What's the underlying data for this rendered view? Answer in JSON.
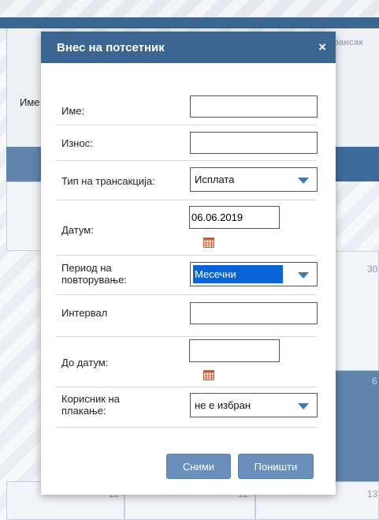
{
  "background": {
    "name_label": "Име",
    "transactions_hint": "трансак",
    "day_numbers": [
      "30",
      "11",
      "12",
      "13",
      "6"
    ]
  },
  "modal": {
    "title": "Внес на потсетник",
    "close_symbol": "×",
    "fields": {
      "name": {
        "label": "Име:",
        "value": ""
      },
      "amount": {
        "label": "Износ:",
        "value": ""
      },
      "transaction_type": {
        "label": "Тип на трансакција:",
        "value": "Исплата"
      },
      "date": {
        "label": "Датум:",
        "value": "06.06.2019"
      },
      "repeat_period": {
        "label_line1": "Период на",
        "label_line2": "повторување:",
        "value": "Месечни"
      },
      "interval": {
        "label": "Интервал",
        "value": ""
      },
      "until_date": {
        "label": "До датум:",
        "value": ""
      },
      "payment_user": {
        "label_line1": "Корисник на",
        "label_line2": "плакање:",
        "value": "не е избран"
      }
    },
    "buttons": {
      "save": "Сними",
      "cancel": "Поништи"
    }
  },
  "colors": {
    "header": "#3d6591",
    "button": "#6a8fba",
    "select_highlight": "#0a64d8",
    "calendar_icon": "#e0542a",
    "dropdown_arrow": "#3a79c0"
  }
}
